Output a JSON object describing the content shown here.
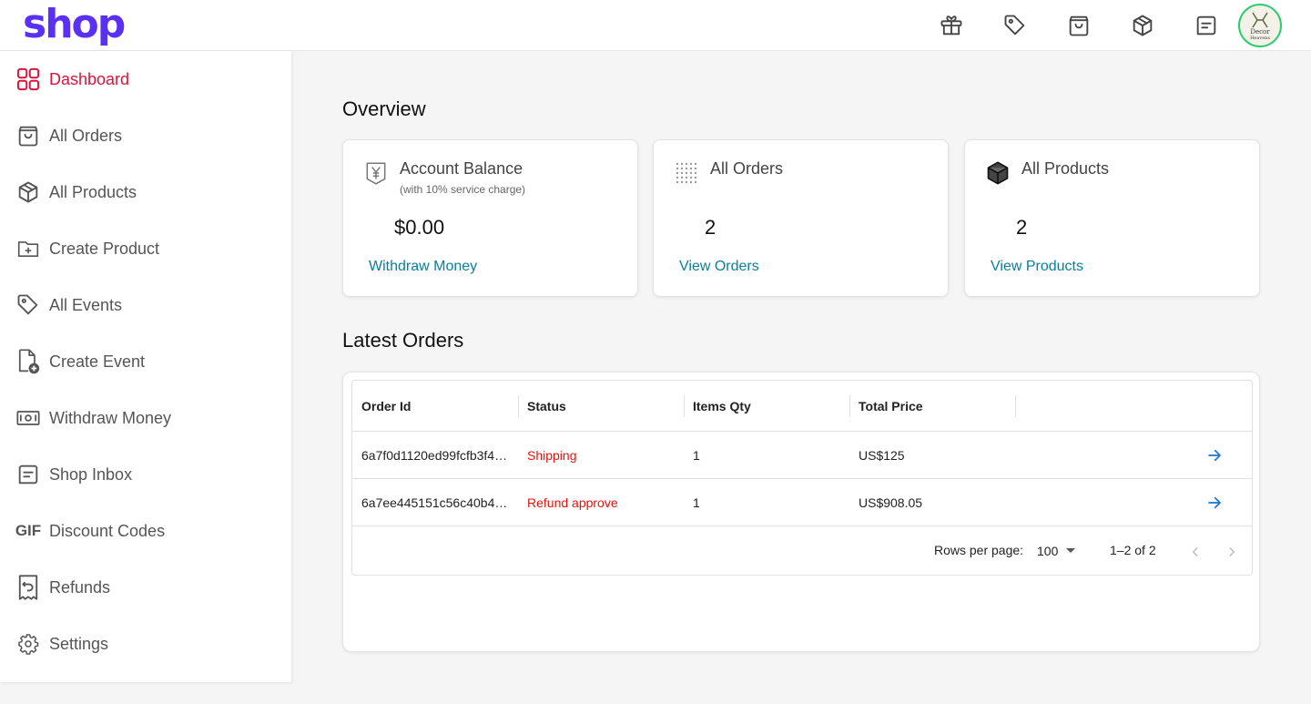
{
  "header": {
    "logo": "shop",
    "icons": [
      "gift-icon",
      "tag-icon",
      "shopping-bag-icon",
      "package-icon",
      "message-icon"
    ],
    "avatar": {
      "line1": "Decor",
      "line2": "Heavens"
    }
  },
  "sidebar": {
    "items": [
      {
        "label": "Dashboard",
        "icon": "dashboard-icon",
        "active": true
      },
      {
        "label": "All Orders",
        "icon": "shopping-bag-icon"
      },
      {
        "label": "All Products",
        "icon": "package-icon"
      },
      {
        "label": "Create Product",
        "icon": "folder-plus-icon"
      },
      {
        "label": "All Events",
        "icon": "tag-icon"
      },
      {
        "label": "Create Event",
        "icon": "file-plus-icon"
      },
      {
        "label": "Withdraw Money",
        "icon": "cash-icon"
      },
      {
        "label": "Shop Inbox",
        "icon": "message-icon"
      },
      {
        "label": "Discount Codes",
        "icon": "gif-icon",
        "icon_text": "GIF"
      },
      {
        "label": "Refunds",
        "icon": "receipt-refund-icon"
      },
      {
        "label": "Settings",
        "icon": "gear-icon"
      }
    ]
  },
  "overview": {
    "title": "Overview",
    "cards": [
      {
        "title": "Account Balance",
        "subtitle": "(with 10% service charge)",
        "value": "$0.00",
        "link": "Withdraw Money",
        "icon": "yen-icon"
      },
      {
        "title": "All Orders",
        "value": "2",
        "link": "View Orders",
        "icon": "dot-grid-icon"
      },
      {
        "title": "All Products",
        "value": "2",
        "link": "View Products",
        "icon": "box-icon"
      }
    ]
  },
  "latest_orders": {
    "title": "Latest Orders",
    "columns": [
      "Order Id",
      "Status",
      "Items Qty",
      "Total Price"
    ],
    "rows": [
      {
        "order_id": "6a7f0d1120ed99fcfb3f4…",
        "status": "Shipping",
        "qty": "1",
        "total": "US$125"
      },
      {
        "order_id": "6a7ee445151c56c40b4…",
        "status": "Refund approve",
        "qty": "1",
        "total": "US$908.05"
      }
    ],
    "footer": {
      "rows_per_page_label": "Rows per page:",
      "rows_per_page_value": "100",
      "range": "1–2 of 2"
    }
  },
  "colors": {
    "brand": "#5a31f4",
    "active": "#dc143c",
    "link": "#077f9c",
    "status_red": "#e8120c",
    "arrow": "#1976d2"
  }
}
